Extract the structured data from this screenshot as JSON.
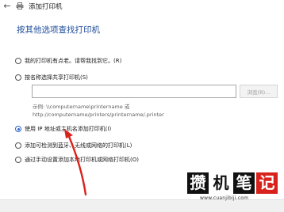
{
  "window": {
    "title": "添加打印机"
  },
  "page": {
    "heading": "按其他选项查找打印机"
  },
  "options": [
    {
      "label": "我的打印机有点老。请帮我找到它。(R)",
      "selected": false
    },
    {
      "label": "按名称选择共享打印机(S)",
      "selected": false
    },
    {
      "label": "使用 IP 地址或主机名添加打印机(I)",
      "selected": true
    },
    {
      "label": "添加可检测到蓝牙、无线或网络的打印机(L)",
      "selected": false
    },
    {
      "label": "通过手动设置添加本地打印机或网络打印机(O)",
      "selected": false
    }
  ],
  "share": {
    "input_value": "",
    "browse_label": "浏览(R)...",
    "example_line1": "示例: \\\\computername\\printername 或",
    "example_line2": "http://computername/printers/printername/.printer"
  },
  "watermark": {
    "chars": [
      "攒",
      "机",
      "笔",
      "记"
    ],
    "url": "www.cuanjibiji.com"
  },
  "colors": {
    "accent": "#2a63c9",
    "heading": "#1f4e9a",
    "arrow": "#d8231c"
  }
}
